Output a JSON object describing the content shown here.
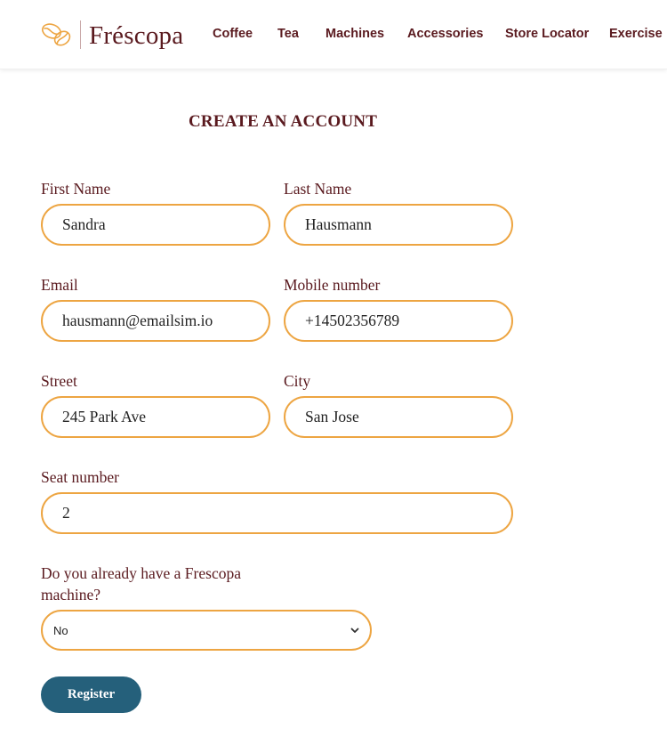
{
  "brand": {
    "name": "Fréscopa",
    "logo_icon": "coffee-beans-icon",
    "primary_color": "#5a1a1f",
    "accent_color": "#eda542",
    "button_color": "#25607b"
  },
  "nav": {
    "items": [
      {
        "label": "Coffee"
      },
      {
        "label": "Tea"
      },
      {
        "label": "Machines"
      },
      {
        "label": "Accessories"
      },
      {
        "label": "Store Locator"
      },
      {
        "label": "Exercise"
      }
    ]
  },
  "form": {
    "title": "CREATE AN ACCOUNT",
    "fields": {
      "first_name": {
        "label": "First Name",
        "value": "Sandra"
      },
      "last_name": {
        "label": "Last Name",
        "value": "Hausmann"
      },
      "email": {
        "label": "Email",
        "value": "hausmann@emailsim.io"
      },
      "mobile": {
        "label": "Mobile number",
        "value": "+14502356789"
      },
      "street": {
        "label": "Street",
        "value": "245 Park Ave"
      },
      "city": {
        "label": "City",
        "value": "San Jose"
      },
      "seat": {
        "label": "Seat number",
        "value": "2"
      }
    },
    "machine_question": {
      "label_line1": "Do you already have a Frescopa",
      "label_line2": "machine?",
      "selected": "No",
      "icon": "chevron-down-icon"
    },
    "submit_label": "Register"
  }
}
